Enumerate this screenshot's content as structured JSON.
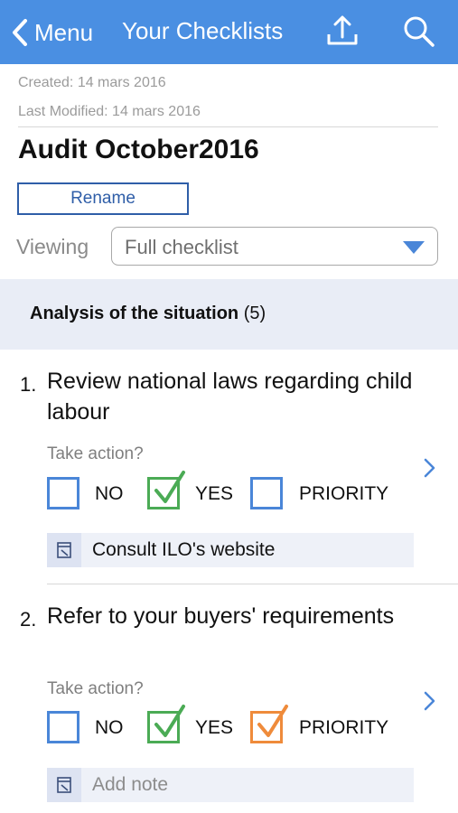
{
  "header": {
    "back_label": "Menu",
    "title": "Your Checklists",
    "bg_color": "#4a8fe2"
  },
  "meta": {
    "created": "Created: 14 mars 2016",
    "modified": "Last Modified: 14 mars 2016"
  },
  "checklist": {
    "title": "Audit October2016",
    "rename_label": "Rename",
    "viewing_label": "Viewing",
    "viewing_value": "Full checklist"
  },
  "section": {
    "title": "Analysis of the situation",
    "count": "(5)"
  },
  "items": [
    {
      "number": "1.",
      "text": "Review national laws regarding child labour",
      "take_action": "Take action?",
      "options": [
        {
          "label": "NO",
          "checked": false,
          "color": "#4a86d8"
        },
        {
          "label": "YES",
          "checked": true,
          "color": "#4bab55"
        },
        {
          "label": "PRIORITY",
          "checked": false,
          "color": "#4a86d8"
        }
      ],
      "note": "Consult ILO's website",
      "note_placeholder": ""
    },
    {
      "number": "2.",
      "text": "Refer to your buyers' requirements",
      "take_action": "Take action?",
      "options": [
        {
          "label": "NO",
          "checked": false,
          "color": "#4a86d8"
        },
        {
          "label": "YES",
          "checked": true,
          "color": "#4bab55"
        },
        {
          "label": "PRIORITY",
          "checked": true,
          "color": "#ef8b3b"
        }
      ],
      "note": "",
      "note_placeholder": "Add note"
    }
  ]
}
